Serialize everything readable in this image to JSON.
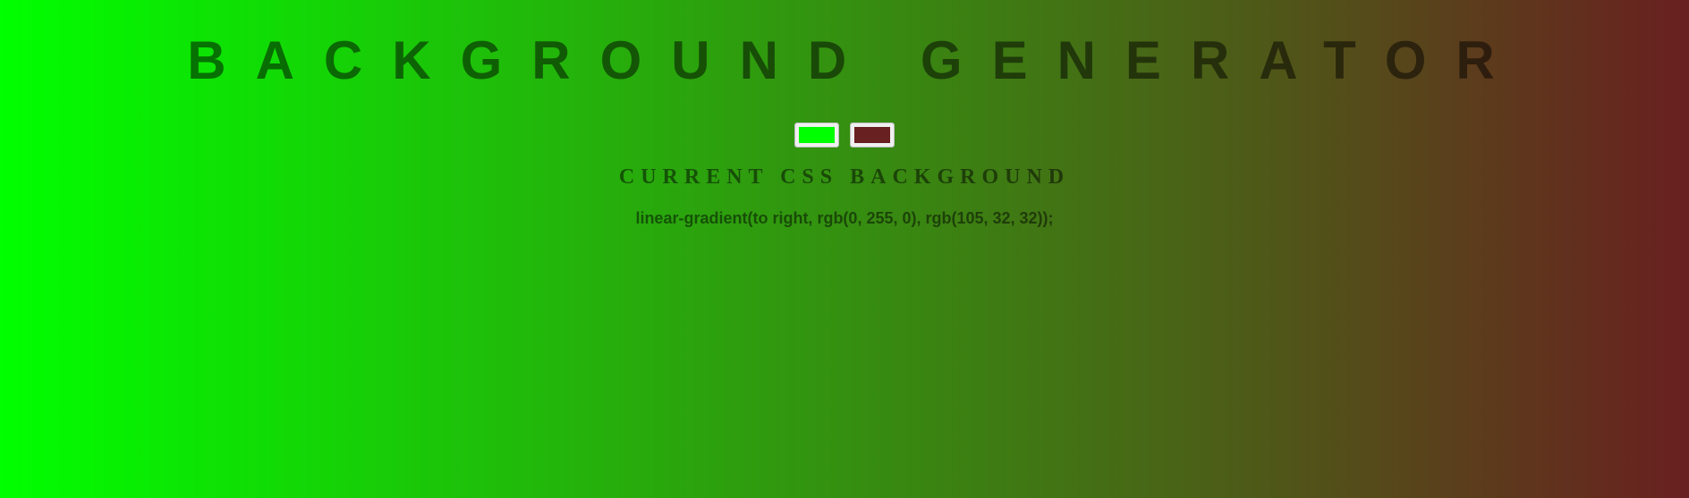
{
  "header": {
    "title": "BACKGROUND GENERATOR"
  },
  "pickers": {
    "color1": "#00ff00",
    "color2": "#692020"
  },
  "output": {
    "heading": "CURRENT CSS BACKGROUND",
    "css_text": "linear-gradient(to right, rgb(0, 255, 0), rgb(105, 32, 32));"
  }
}
